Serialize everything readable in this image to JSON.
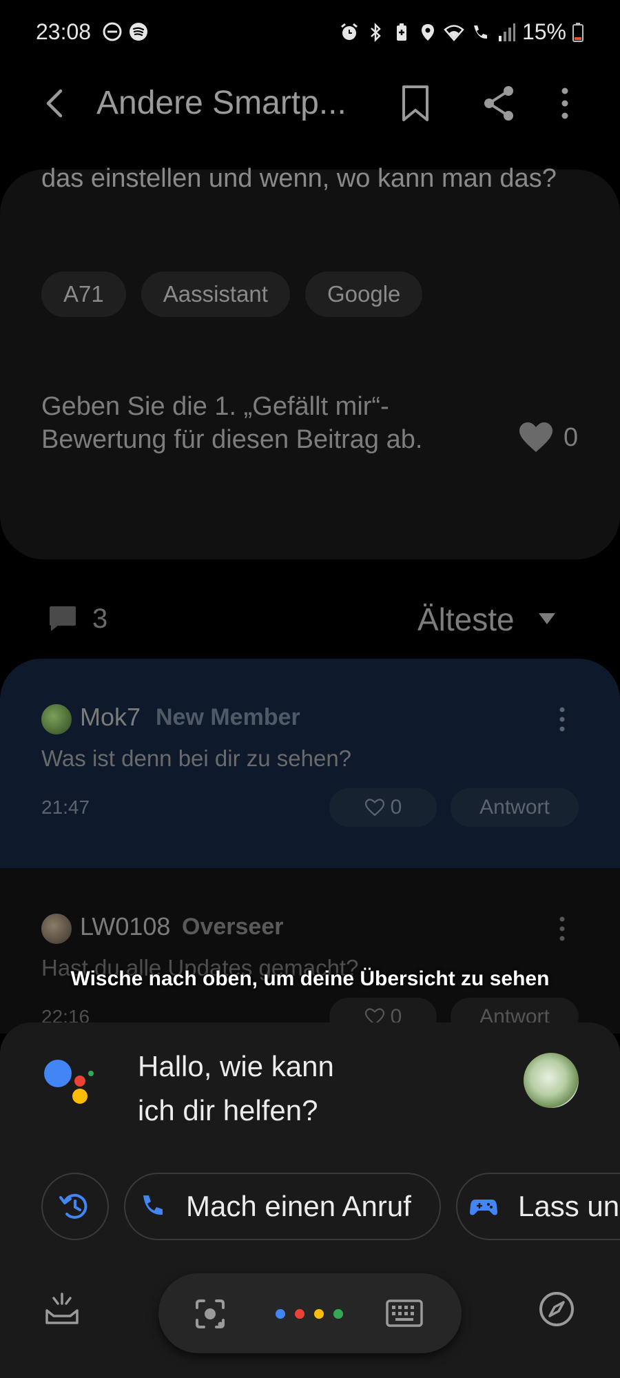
{
  "status_bar": {
    "time": "23:08",
    "battery": "15%",
    "left_icons": [
      "dnd-icon",
      "spotify-icon"
    ],
    "right_icons": [
      "alarm-icon",
      "bluetooth-icon",
      "battery-saver-icon",
      "location-icon",
      "wifi-icon",
      "wifi-call-icon",
      "signal-icon",
      "battery-icon"
    ]
  },
  "app_bar": {
    "title": "Andere Smartp..."
  },
  "post": {
    "body_tail": "das einstellen und wenn, wo kann man das?",
    "tags": [
      "A71",
      "Aassistant",
      "Google"
    ],
    "like_prompt": "Geben Sie die 1. „Gefällt mir“-Bewertung für diesen Beitrag ab.",
    "like_count": "0"
  },
  "comments_header": {
    "count": "3",
    "sort": "Älteste"
  },
  "comments": [
    {
      "user": "Mok7",
      "rank": "New Member",
      "text": "Was ist denn bei dir zu sehen?",
      "time": "21:47",
      "likes": "0",
      "reply": "Antwort"
    },
    {
      "user": "LW0108",
      "rank": "Overseer",
      "text": "Hast du alle Updates gemacht?",
      "time": "22:16",
      "likes": "0",
      "reply": "Antwort"
    }
  ],
  "hint": "Wische nach oben, um deine Übersicht zu sehen",
  "assistant": {
    "greeting": "Hallo, wie kann ich dir helfen?",
    "chips": [
      {
        "label": "Mach einen Anruf",
        "icon": "phone-icon"
      },
      {
        "label": "Lass uns",
        "icon": "gamepad-icon"
      }
    ],
    "accent": "#4285F4",
    "dot_colors": [
      "#4285F4",
      "#EA4335",
      "#FBBC05",
      "#34A853"
    ]
  }
}
